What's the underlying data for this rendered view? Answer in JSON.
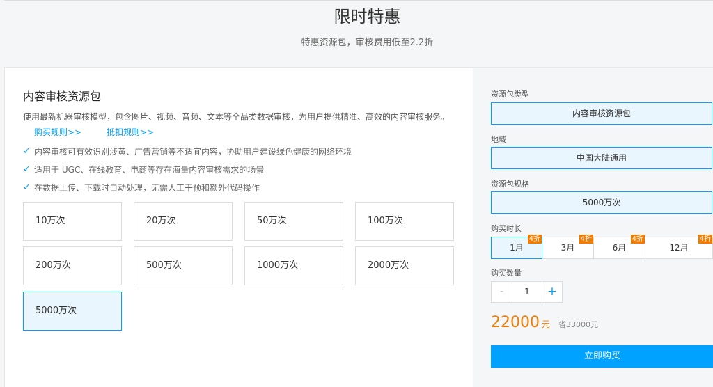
{
  "header": {
    "title": "限时特惠",
    "subtitle": "特惠资源包，审核费用低至2.2折"
  },
  "package": {
    "title": "内容审核资源包",
    "description": "使用最新机器审核模型，包含图片、视频、音频、文本等全品类数据审核，为用户提供精准、高效的内容审核服务。",
    "purchase_rules_link": "购买规则>>",
    "deduction_rules_link": "抵扣规则>>",
    "features": [
      "内容审核可有效识别涉黄、广告营销等不适宜内容，协助用户建设绿色健康的网络环境",
      "适用于 UGC、在线教育、电商等存在海量内容审核需求的场景",
      "在数据上传、下载时自动处理，无需人工干预和额外代码操作"
    ],
    "options": [
      "10万次",
      "20万次",
      "50万次",
      "100万次",
      "200万次",
      "500万次",
      "1000万次",
      "2000万次",
      "5000万次"
    ],
    "selected_option": "5000万次"
  },
  "config": {
    "type_label": "资源包类型",
    "type_value": "内容审核资源包",
    "region_label": "地域",
    "region_value": "中国大陆通用",
    "spec_label": "资源包规格",
    "spec_value": "5000万次",
    "duration_label": "购买时长",
    "durations": [
      {
        "label": "1月",
        "badge": "4折"
      },
      {
        "label": "3月",
        "badge": "4折"
      },
      {
        "label": "6月",
        "badge": "4折"
      },
      {
        "label": "12月",
        "badge": "4折"
      }
    ],
    "selected_duration": "1月",
    "quantity_label": "购买数量",
    "quantity_minus": "-",
    "quantity_value": "1",
    "quantity_plus": "+",
    "price": "22000",
    "price_unit": "元",
    "savings": "省33000元",
    "buy_button": "立即购买"
  },
  "colors": {
    "accent": "#00a2ff",
    "price": "#f07c00",
    "selected_bg": "#eaf6fd"
  }
}
